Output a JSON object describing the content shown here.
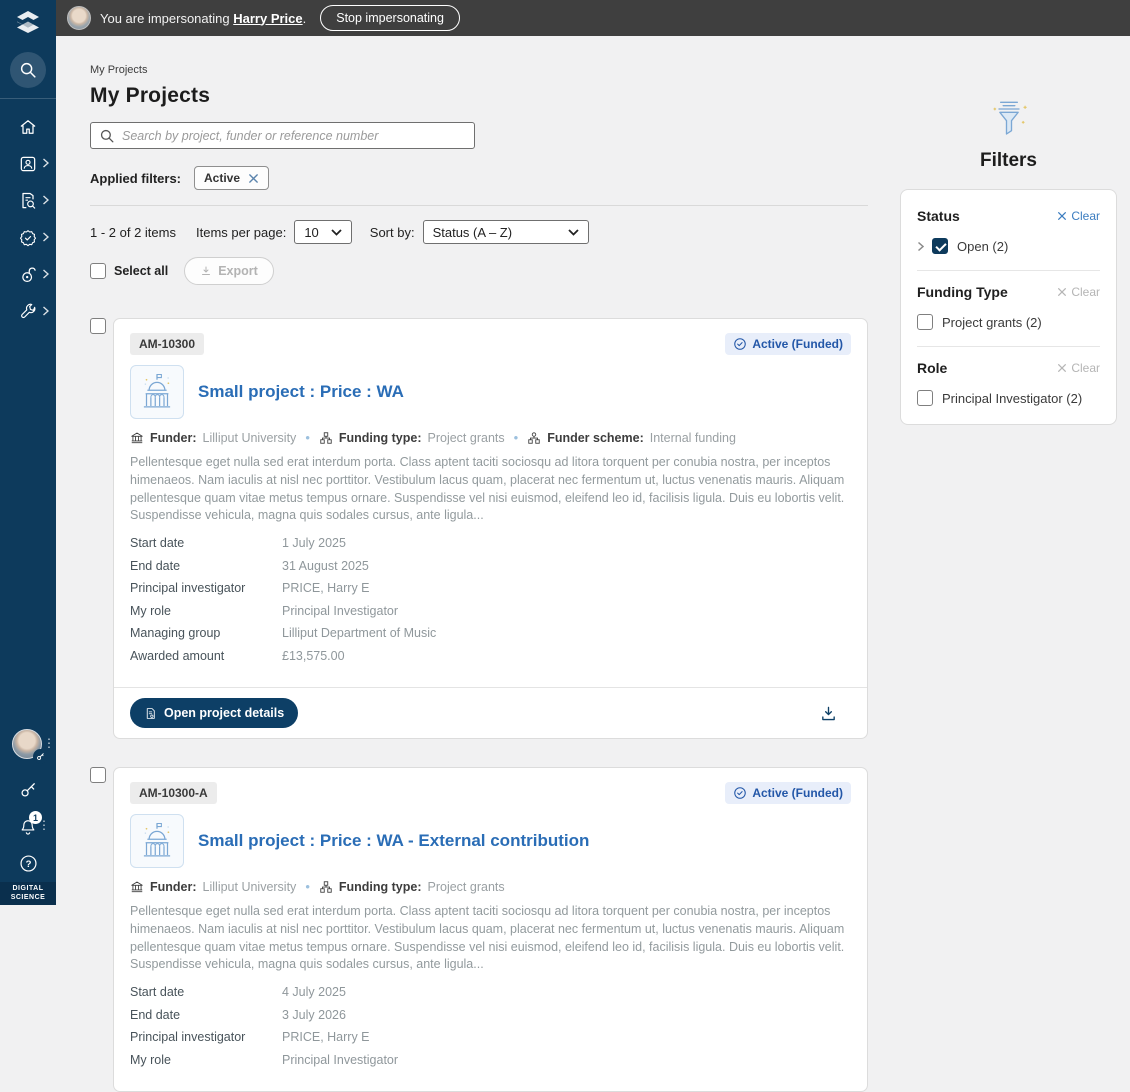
{
  "topbar": {
    "impersonating_text": "You are impersonating",
    "user_name": "Harry Price",
    "suffix": ".",
    "stop_button": "Stop impersonating"
  },
  "sidebar": {
    "notification_count": "1",
    "brand_line1": "DIGITAL",
    "brand_line2": "SCIENCE"
  },
  "page": {
    "breadcrumb": "My Projects",
    "title": "My Projects"
  },
  "search": {
    "placeholder": "Search by project, funder or reference number"
  },
  "applied_filters": {
    "label": "Applied filters:",
    "chips": [
      {
        "label": "Active"
      }
    ]
  },
  "toolbar": {
    "count_text": "1 - 2 of 2 items",
    "items_per_page_label": "Items per page:",
    "items_per_page_value": "10",
    "sort_label": "Sort by:",
    "sort_value": "Status (A – Z)",
    "select_all_label": "Select all",
    "export_label": "Export"
  },
  "projects": [
    {
      "id": "AM-10300",
      "status": "Active (Funded)",
      "title": "Small project : Price : WA",
      "meta": [
        {
          "label": "Funder:",
          "value": "Lilliput University"
        },
        {
          "label": "Funding type:",
          "value": "Project grants"
        },
        {
          "label": "Funder scheme:",
          "value": "Internal funding"
        }
      ],
      "description": "Pellentesque eget nulla sed erat interdum porta. Class aptent taciti sociosqu ad litora torquent per conubia nostra, per inceptos himenaeos. Nam iaculis at nisl nec porttitor. Vestibulum lacus quam, placerat nec fermentum ut, luctus venenatis mauris. Aliquam pellentesque quam vitae metus tempus ornare. Suspendisse vel nisi euismod, eleifend leo id, facilisis ligula. Duis eu lobortis velit. Suspendisse vehicula, magna quis sodales cursus, ante ligula...",
      "details": [
        {
          "label": "Start date",
          "value": "1 July 2025"
        },
        {
          "label": "End date",
          "value": "31 August 2025"
        },
        {
          "label": "Principal investigator",
          "value": "PRICE, Harry E"
        },
        {
          "label": "My role",
          "value": "Principal Investigator"
        },
        {
          "label": "Managing group",
          "value": "Lilliput Department of Music"
        },
        {
          "label": "Awarded amount",
          "value": "£13,575.00"
        }
      ],
      "open_button": "Open project details"
    },
    {
      "id": "AM-10300-A",
      "status": "Active (Funded)",
      "title": "Small project : Price : WA - External contribution",
      "meta": [
        {
          "label": "Funder:",
          "value": "Lilliput University"
        },
        {
          "label": "Funding type:",
          "value": "Project grants"
        }
      ],
      "description": "Pellentesque eget nulla sed erat interdum porta. Class aptent taciti sociosqu ad litora torquent per conubia nostra, per inceptos himenaeos. Nam iaculis at nisl nec porttitor. Vestibulum lacus quam, placerat nec fermentum ut, luctus venenatis mauris. Aliquam pellentesque quam vitae metus tempus ornare. Suspendisse vel nisi euismod, eleifend leo id, facilisis ligula. Duis eu lobortis velit. Suspendisse vehicula, magna quis sodales cursus, ante ligula...",
      "details": [
        {
          "label": "Start date",
          "value": "4 July 2025"
        },
        {
          "label": "End date",
          "value": "3 July 2026"
        },
        {
          "label": "Principal investigator",
          "value": "PRICE, Harry E"
        },
        {
          "label": "My role",
          "value": "Principal Investigator"
        }
      ]
    }
  ],
  "filters_panel": {
    "title": "Filters",
    "sections": [
      {
        "title": "Status",
        "clear_label": "Clear",
        "option": "Open (2)"
      },
      {
        "title": "Funding Type",
        "clear_label": "Clear",
        "option": "Project grants (2)"
      },
      {
        "title": "Role",
        "clear_label": "Clear",
        "option": "Principal Investigator (2)"
      }
    ]
  },
  "colors": {
    "sidebar_navy": "#0d3a5c",
    "topbar_gray": "#3f3f3f",
    "page_bg": "#f1f1f2",
    "title_blue": "#2a6db6",
    "status_badge_bg": "#e8eefa",
    "status_badge_text": "#2357a8",
    "primary_button": "#0d3f66",
    "clear_link_blue": "#3c7dc0"
  }
}
